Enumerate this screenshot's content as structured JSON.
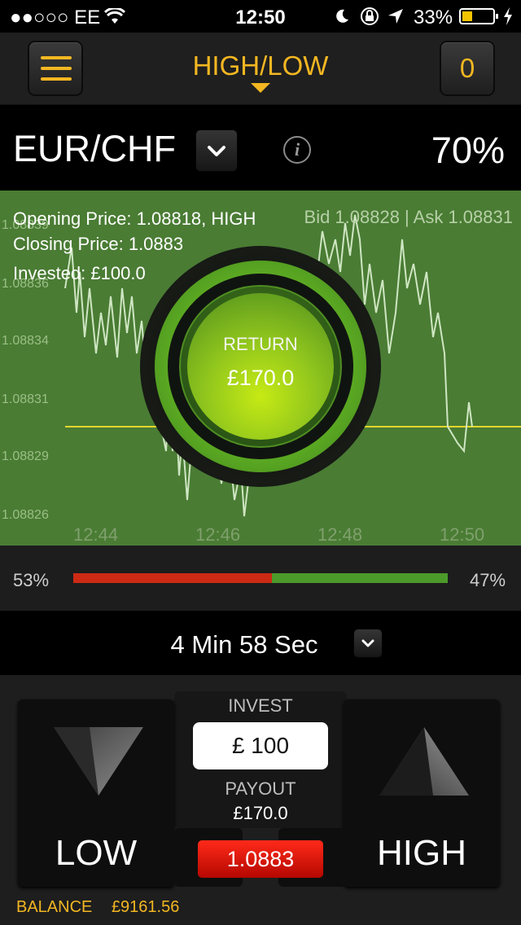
{
  "status_bar": {
    "carrier": "●●○○○ EE",
    "time": "12:50",
    "battery": "33%"
  },
  "header": {
    "title": "HIGH/LOW",
    "counter": "0"
  },
  "asset": {
    "name": "EUR/CHF",
    "payout_pct": "70%",
    "info_glyph": "i"
  },
  "chart": {
    "opening_price": "Opening Price: 1.08818, HIGH",
    "bid_ask": "Bid 1.08828 | Ask 1.08831",
    "closing_price": "Closing Price: 1.0883",
    "invested": "Invested: £100.0",
    "return_label": "RETURN",
    "return_value": "£170.0",
    "y_ticks": [
      "1.08839",
      "1.08836",
      "1.08834",
      "1.08831",
      "1.08829",
      "1.08826"
    ],
    "x_ticks": [
      "12:44",
      "12:46",
      "12:48",
      "12:50"
    ],
    "colors": {
      "background": "#4a7c34",
      "price_line": "#cfe6c2",
      "strike_line": "#e5d62c"
    }
  },
  "sentiment": {
    "low_pct": "53%",
    "high_pct": "47%",
    "low_fraction": 0.53,
    "low_color": "#cc2a14",
    "high_color": "#4c9a2a"
  },
  "timer": {
    "text": "4 Min 58 Sec"
  },
  "trade": {
    "low_label": "LOW",
    "high_label": "HIGH",
    "invest_label": "INVEST",
    "invest_value": "£ 100",
    "payout_label": "PAYOUT",
    "payout_value": "£170.0",
    "current_price": "1.0883",
    "balance_label": "BALANCE",
    "balance_value": "£9161.56"
  },
  "icons": [
    "wifi-icon",
    "moon-icon",
    "rotation-lock-icon",
    "location-arrow-icon",
    "battery-icon",
    "charging-bolt-icon",
    "hamburger-menu-icon",
    "chevron-down-icon",
    "info-icon",
    "down-triangle-icon",
    "up-triangle-icon"
  ],
  "accent_color": "#f4b722"
}
